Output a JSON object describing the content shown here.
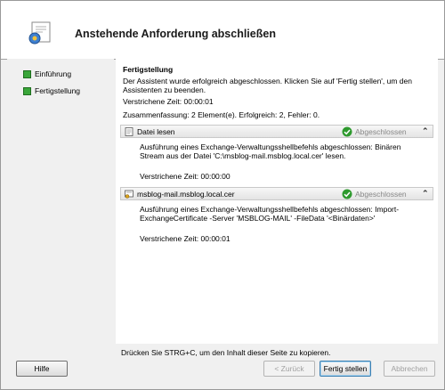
{
  "header": {
    "title": "Anstehende Anforderung abschließen",
    "icon": "certificate-wizard-icon"
  },
  "nav": {
    "items": [
      {
        "label": "Einführung",
        "icon": "green-square-icon"
      },
      {
        "label": "Fertigstellung",
        "icon": "green-square-icon"
      }
    ]
  },
  "main": {
    "heading": "Fertigstellung",
    "description": "Der Assistent wurde erfolgreich abgeschlossen. Klicken Sie auf 'Fertig stellen', um den Assistenten zu beenden.",
    "elapsed": "Verstrichene Zeit: 00:00:01",
    "summary": "Zusammenfassung: 2 Element(e). Erfolgreich: 2, Fehler: 0.",
    "steps": [
      {
        "name": "Datei lesen",
        "status": "Abgeschlossen",
        "body": "Ausführung eines Exchange-Verwaltungsshellbefehls abgeschlossen: Binären Stream aus der Datei 'C:\\msblog-mail.msblog.local.cer' lesen.",
        "time": "Verstrichene Zeit: 00:00:00"
      },
      {
        "name": "msblog-mail.msblog.local.cer",
        "status": "Abgeschlossen",
        "body": "Ausführung eines Exchange-Verwaltungsshellbefehls abgeschlossen: Import-ExchangeCertificate -Server 'MSBLOG-MAIL' -FileData '<Binärdaten>'",
        "time": "Verstrichene Zeit: 00:00:01"
      }
    ]
  },
  "footer": {
    "copy_hint": "Drücken Sie STRG+C, um den Inhalt dieser Seite zu kopieren.",
    "help_label": "Hilfe",
    "back_label": "< Zurück",
    "finish_label": "Fertig stellen",
    "cancel_label": "Abbrechen"
  },
  "colors": {
    "accent_green": "#3aa63a",
    "ok_green": "#2e9a2e"
  }
}
